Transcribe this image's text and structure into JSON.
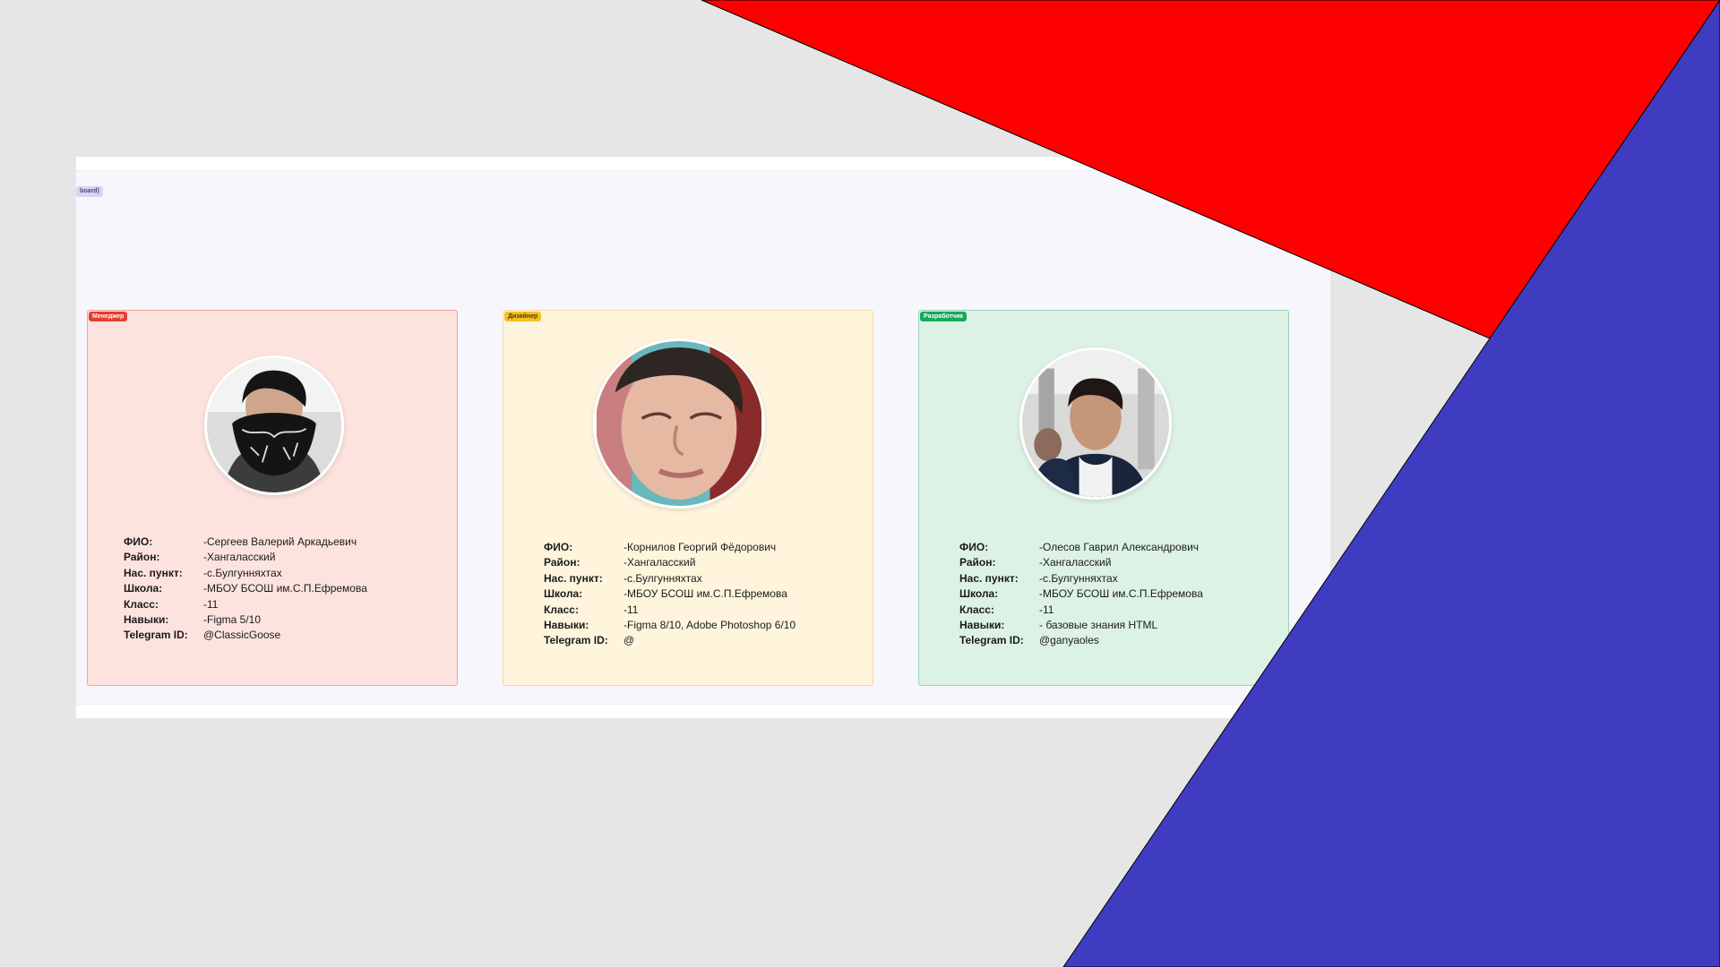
{
  "board": {
    "frame_badge": "board)"
  },
  "fields": {
    "fio": "ФИО:",
    "district": "Район:",
    "settlement": "Нас. пункт:",
    "school": "Школа:",
    "class": "Класс:",
    "skills": "Навыки:",
    "telegram": "Telegram ID:"
  },
  "cards": [
    {
      "role": "Менеджер",
      "fio": "-Сергеев Валерий Аркадьевич",
      "district": "-Хангаласский",
      "settlement": "-с.Булгунняхтах",
      "school": "-МБОУ БСОШ им.С.П.Ефремова",
      "class": "-11",
      "skills": "-Figma 5/10",
      "telegram": "@ClassicGoose"
    },
    {
      "role": "Дизайнер",
      "fio": "-Корнилов Георгий Фёдорович",
      "district": "-Хангаласский",
      "settlement": "-с.Булгунняхтах",
      "school": "-МБОУ БСОШ им.С.П.Ефремова",
      "class": "-11",
      "skills": "-Figma 8/10, Adobe Photoshop 6/10",
      "telegram": "@"
    },
    {
      "role": "Разработчик",
      "fio": "-Олесов Гаврил Александрович",
      "district": "-Хангаласский",
      "settlement": "-с.Булгунняхтах",
      "school": "-МБОУ БСОШ им.С.П.Ефремова",
      "class": "-11",
      "skills": "- базовые знания HTML",
      "telegram": "@ganyaoles"
    }
  ],
  "colors": {
    "background": "#e6e6e6",
    "red_shape": "#ff0000",
    "blue_shape": "#403cc1",
    "manager": "#fde3de",
    "designer": "#fff5dd",
    "developer": "#dcf2e5"
  }
}
